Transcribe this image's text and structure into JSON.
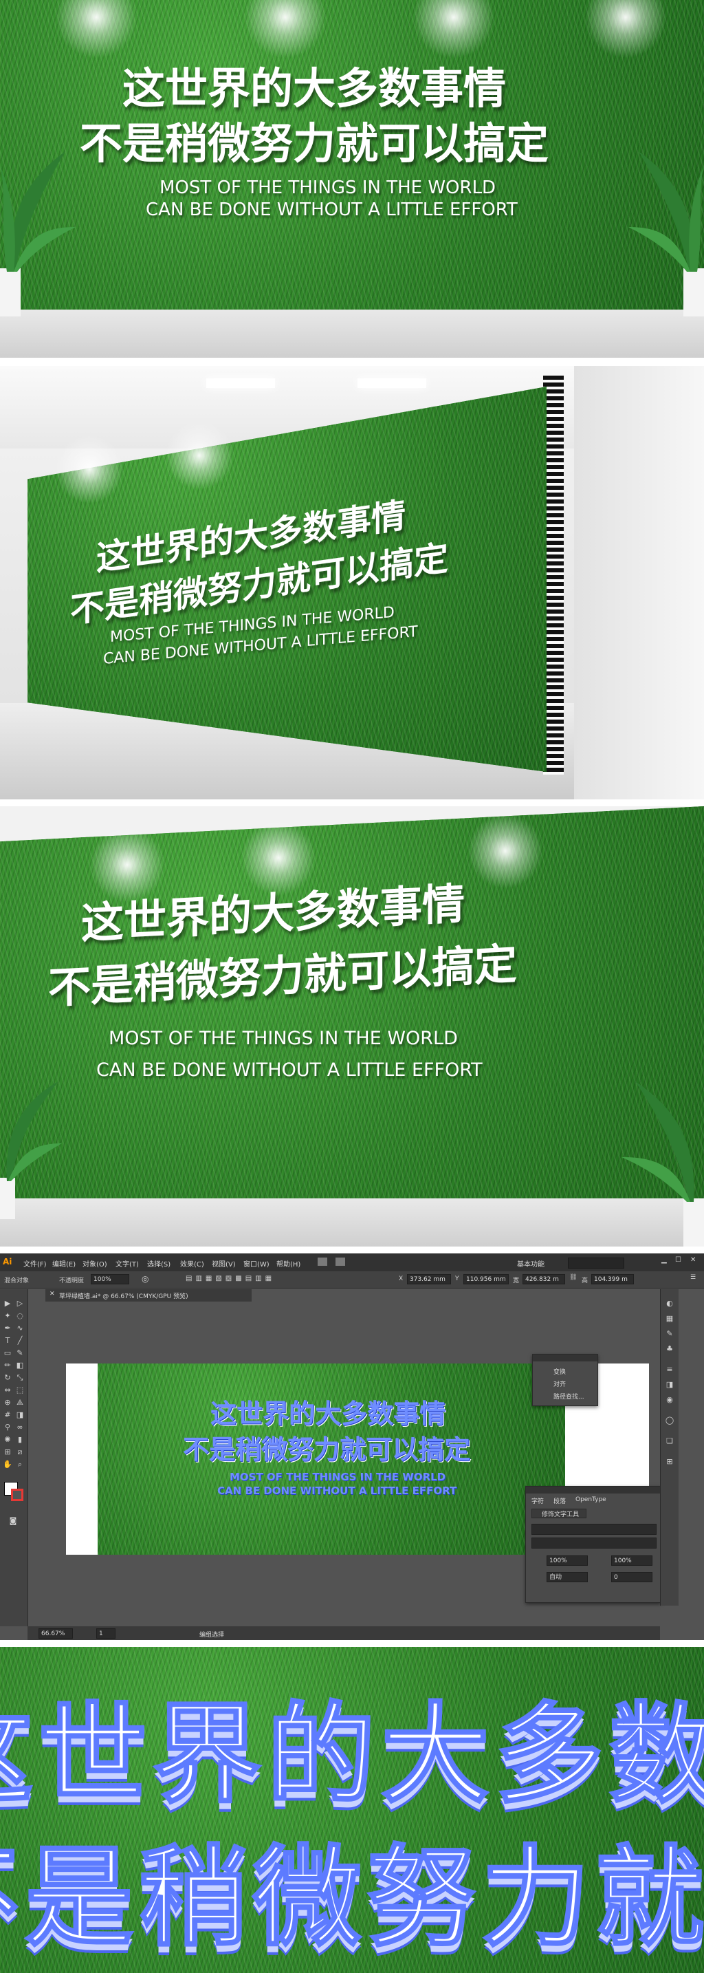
{
  "headline": {
    "line1": "这世界的大多数事情",
    "line2": "不是稍微努力就可以搞定",
    "en1": "MOST OF THE THINGS IN THE WORLD",
    "en2": "CAN BE DONE WITHOUT A LITTLE EFFORT"
  },
  "colors": {
    "grass": "#2f8a2a",
    "outline_blue": "#5d7bff",
    "ai_bg": "#535353"
  },
  "illustrator": {
    "logo": "Ai",
    "menus": [
      "文件(F)",
      "编辑(E)",
      "对象(O)",
      "文字(T)",
      "选择(S)",
      "效果(C)",
      "视图(V)",
      "窗口(W)",
      "帮助(H)"
    ],
    "workspace": "基本功能",
    "control": {
      "left_label": "混合对象",
      "opacity_label": "不透明度",
      "opacity_value": "100%",
      "x_label": "X",
      "x_value": "373.62 mm",
      "y_label": "Y",
      "y_value": "110.956 mm",
      "w_label": "宽",
      "w_value": "426.832 m",
      "h_label": "高",
      "h_value": "104.399 m"
    },
    "doc_tab": "草坪绿植墙.ai* @ 66.67% (CMYK/GPU 预览)",
    "float_menu": [
      "变换",
      "对齐",
      "路径查找..."
    ],
    "char_panel": {
      "tabs": [
        "字符",
        "段落",
        "OpenType"
      ],
      "tool": "修饰文字工具",
      "font_size_1": "100%",
      "font_size_2": "100%",
      "tracking": "自动",
      "kerning": "0"
    },
    "status": {
      "zoom": "66.67%",
      "page": "1",
      "mode": "编组选择"
    }
  }
}
